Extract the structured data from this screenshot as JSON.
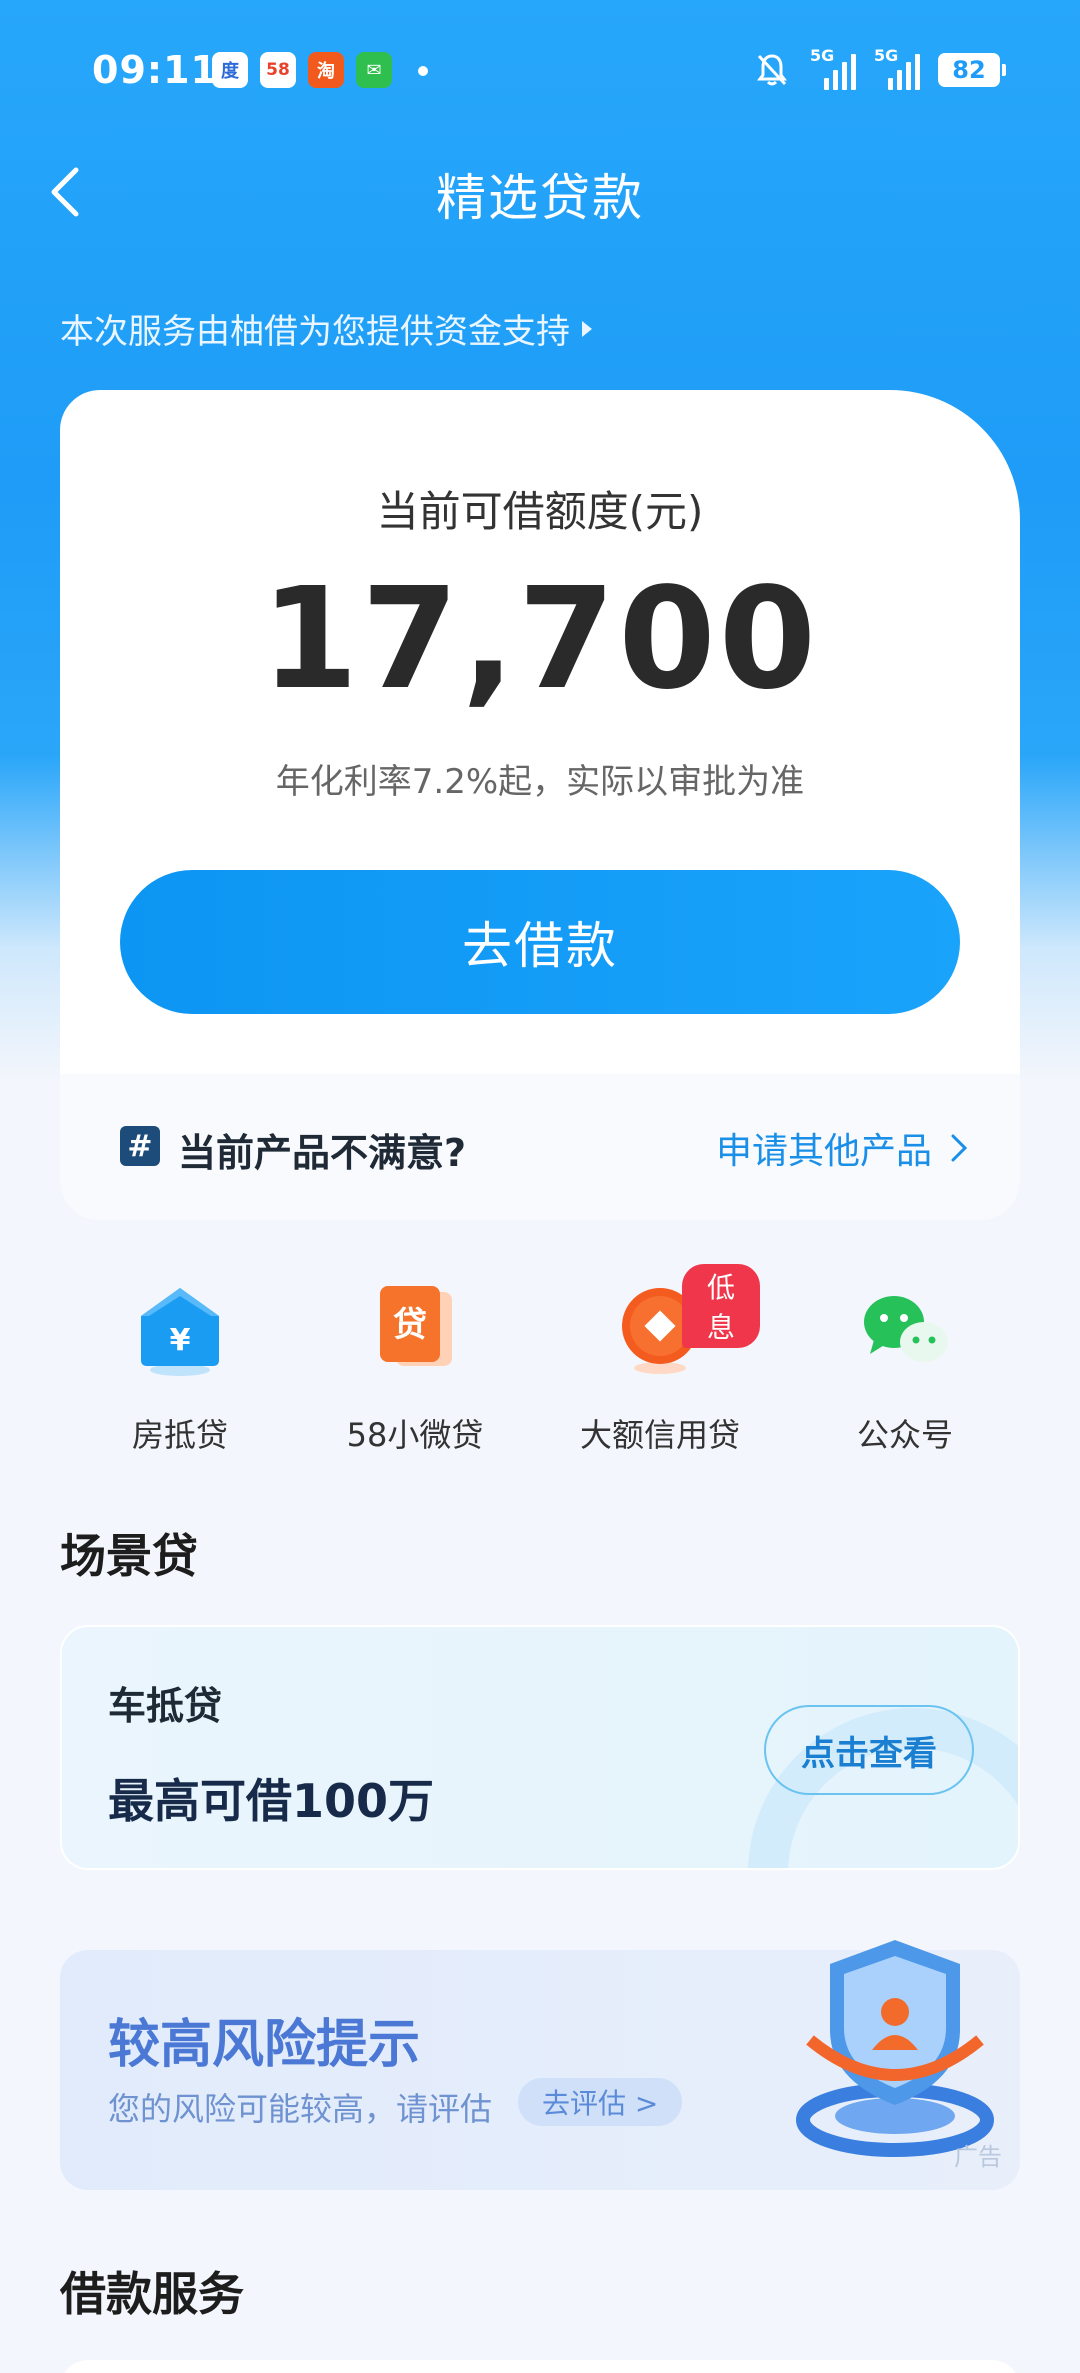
{
  "status_bar": {
    "time": "09:11",
    "apps": [
      "baidu-app-icon",
      "58-app-icon",
      "taobao-app-icon",
      "messages-app-icon"
    ],
    "app_labels": [
      "度",
      "58",
      "淘",
      "✉"
    ],
    "network": [
      "5G",
      "5G"
    ],
    "battery": "82"
  },
  "header": {
    "title": "精选贷款",
    "provider_text": "本次服务由柚借为您提供资金支持"
  },
  "main_card": {
    "limit_label": "当前可借额度(元)",
    "amount": "17,700",
    "rate_text": "年化利率7.2%起，实际以审批为准",
    "borrow_button": "去借款",
    "not_satisfied_text": "当前产品不满意?",
    "other_products_link": "申请其他产品",
    "hash_symbol": "#"
  },
  "quick_entries": [
    {
      "label": "房抵贷",
      "icon": "house-icon"
    },
    {
      "label": "58小微贷",
      "icon": "loan-icon",
      "glyph": "贷"
    },
    {
      "label": "大额信用贷",
      "icon": "coin-icon",
      "badge": "低息"
    },
    {
      "label": "公众号",
      "icon": "wechat-icon"
    }
  ],
  "scene_loan": {
    "section_title": "场景贷",
    "car_title": "车抵贷",
    "car_subtitle": "最高可借100万",
    "car_button": "点击查看"
  },
  "risk_ad": {
    "title": "较高风险提示",
    "subtitle": "您的风险可能较高，请评估",
    "button": "去评估 >",
    "ad_label": "广告"
  },
  "loan_service": {
    "section_title": "借款服务"
  },
  "colors": {
    "primary": "#1aa3fb",
    "badge_red": "#f0364a",
    "risk_blue": "#4a78d4"
  }
}
